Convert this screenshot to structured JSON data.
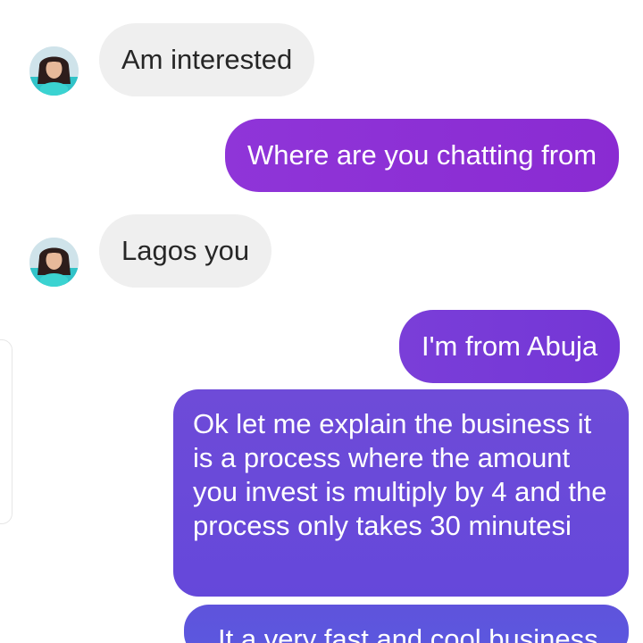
{
  "messages": [
    {
      "side": "incoming",
      "text": "Am interested",
      "avatar": "contact-avatar"
    },
    {
      "side": "outgoing",
      "text": "Where are you chatting from"
    },
    {
      "side": "incoming",
      "text": "Lagos you",
      "avatar": "contact-avatar"
    },
    {
      "side": "outgoing",
      "text": "I'm from Abuja"
    },
    {
      "side": "outgoing",
      "text": "Ok let me explain the business it is a process where the amount you invest is multiply by 4 and the process only takes  30 minutesi"
    },
    {
      "side": "outgoing",
      "text": "It a very fast and cool business"
    }
  ],
  "colors": {
    "incoming_bubble": "#efefef",
    "incoming_text": "#262626",
    "outgoing_purple": "#8a2bd2",
    "outgoing_indigo": "#5a59df"
  }
}
